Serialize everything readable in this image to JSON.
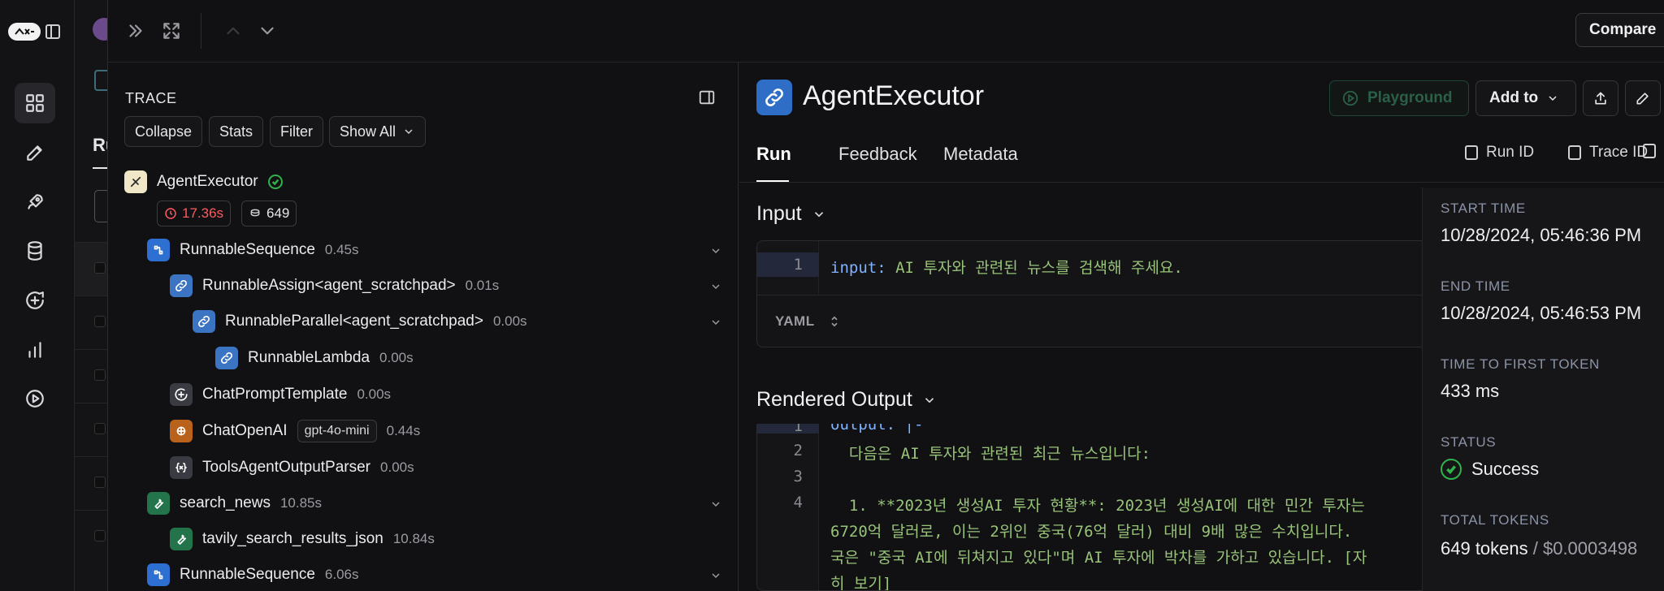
{
  "rail": {
    "icons": [
      "grid-icon",
      "pen-icon",
      "rocket-icon",
      "database-icon",
      "chat-plus-icon",
      "bar-chart-icon",
      "play-circle-icon"
    ]
  },
  "background_page": {
    "tab_partial": "Ru"
  },
  "topbar": {
    "compare_label": "Compare"
  },
  "trace": {
    "title": "TRACE",
    "buttons": {
      "collapse": "Collapse",
      "stats": "Stats",
      "filter": "Filter",
      "show_all": "Show All"
    },
    "root": {
      "name": "AgentExecutor",
      "time": "17.36s",
      "tokens": "649"
    },
    "nodes": [
      {
        "name": "RunnableSequence",
        "duration": "0.45s",
        "icon": "chain-icon"
      },
      {
        "name": "RunnableAssign<agent_scratchpad>",
        "duration": "0.01s",
        "icon": "link-icon"
      },
      {
        "name": "RunnableParallel<agent_scratchpad>",
        "duration": "0.00s",
        "icon": "link-icon"
      },
      {
        "name": "RunnableLambda",
        "duration": "0.00s",
        "icon": "link-icon"
      },
      {
        "name": "ChatPromptTemplate",
        "duration": "0.00s",
        "icon": "prompt-icon"
      },
      {
        "name": "ChatOpenAI",
        "model": "gpt-4o-mini",
        "duration": "0.44s",
        "icon": "openai-icon"
      },
      {
        "name": "ToolsAgentOutputParser",
        "duration": "0.00s",
        "icon": "parser-icon"
      },
      {
        "name": "search_news",
        "duration": "10.85s",
        "icon": "wrench-icon"
      },
      {
        "name": "tavily_search_results_json",
        "duration": "10.84s",
        "icon": "wrench-icon"
      },
      {
        "name": "RunnableSequence",
        "duration": "6.06s",
        "icon": "chain-icon"
      }
    ]
  },
  "detail": {
    "title": "AgentExecutor",
    "playground_label": "Playground",
    "add_to_label": "Add to",
    "tabs": [
      "Run",
      "Feedback",
      "Metadata"
    ],
    "run_id_label": "Run ID",
    "trace_id_label": "Trace ID",
    "input": {
      "heading": "Input",
      "line_no": "1",
      "key": "input:",
      "value": " AI 투자와 관련된 뉴스를 검색해 주세요.",
      "format": "YAML"
    },
    "output": {
      "heading": "Rendered Output",
      "line_numbers": [
        "1",
        "2",
        "3",
        "4"
      ],
      "lines": [
        "output: |-",
        "  다음은 AI 투자와 관련된 최근 뉴스입니다:",
        "",
        "  1. **2023년 생성AI 투자 현황**: 2023년 생성AI에 대한 민간 투자는",
        "6720억 달러로, 이는 2위인 중국(76억 달러) 대비 9배 많은 수치입니다.",
        "국은 \"중국 AI에 뒤쳐지고 있다\"며 AI 투자에 박차를 가하고 있습니다. [자",
        "히 보기]"
      ]
    }
  },
  "meta": {
    "start_time_label": "START TIME",
    "start_time": "10/28/2024, 05:46:36 PM",
    "end_time_label": "END TIME",
    "end_time": "10/28/2024, 05:46:53 PM",
    "ttft_label": "TIME TO FIRST TOKEN",
    "ttft": "433 ms",
    "status_label": "STATUS",
    "status": "Success",
    "total_tokens_label": "TOTAL TOKENS",
    "total_tokens": "649 tokens",
    "cost": " / $0.0003498"
  },
  "colors": {
    "accent_blue": "#2e6fd2",
    "success_green": "#2fb34a",
    "error_red": "#ff5a5f"
  }
}
